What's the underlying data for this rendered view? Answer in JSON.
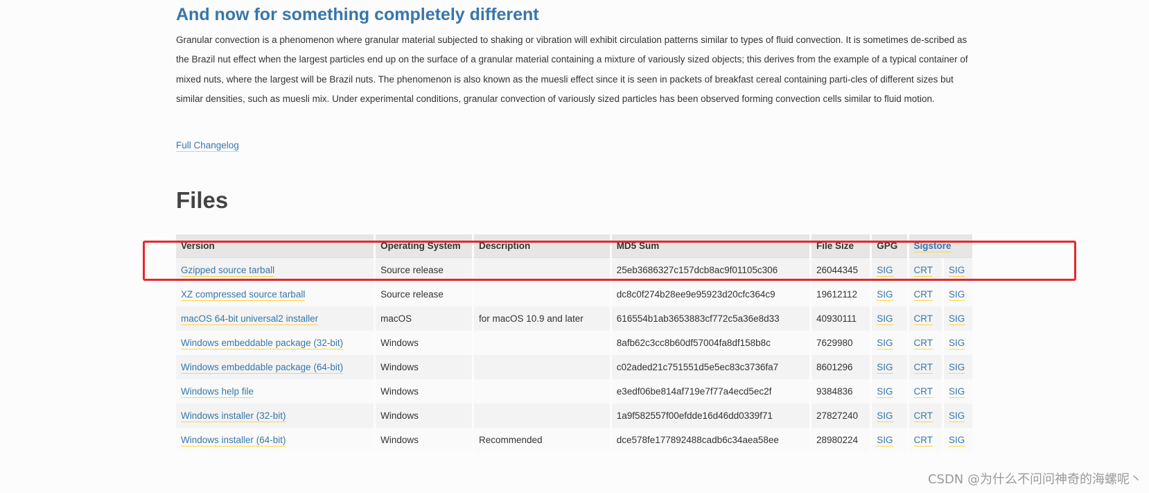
{
  "section": {
    "title": "And now for something completely different",
    "body": "Granular convection is a phenomenon where granular material subjected to shaking or vibration will exhibit circulation patterns similar to types of fluid convection. It is sometimes de-scribed as the Brazil nut effect when the largest particles end up on the surface of a granular material containing a mixture of variously sized objects; this derives from the example of a typical container of mixed nuts, where the largest will be Brazil nuts. The phenomenon is also known as the muesli effect since it is seen in packets of breakfast cereal containing parti-cles of different sizes but similar densities, such as muesli mix. Under experimental conditions, granular convection of variously sized particles has been observed forming convection cells similar to fluid motion.",
    "changelog_label": "Full Changelog"
  },
  "files": {
    "title": "Files",
    "headers": {
      "version": "Version",
      "os": "Operating System",
      "description": "Description",
      "md5": "MD5 Sum",
      "size": "File Size",
      "gpg": "GPG",
      "sigstore": "Sigstore"
    },
    "rows": [
      {
        "version": "Gzipped source tarball",
        "os": "Source release",
        "description": "",
        "md5": "25eb3686327c157dcb8ac9f01105c306",
        "size": "26044345",
        "gpg": "SIG",
        "crt": "CRT",
        "sig": "SIG"
      },
      {
        "version": "XZ compressed source tarball",
        "os": "Source release",
        "description": "",
        "md5": "dc8c0f274b28ee9e95923d20cfc364c9",
        "size": "19612112",
        "gpg": "SIG",
        "crt": "CRT",
        "sig": "SIG"
      },
      {
        "version": "macOS 64-bit universal2 installer",
        "os": "macOS",
        "description": "for macOS 10.9 and later",
        "md5": "616554b1ab3653883cf772c5a36e8d33",
        "size": "40930111",
        "gpg": "SIG",
        "crt": "CRT",
        "sig": "SIG"
      },
      {
        "version": "Windows embeddable package (32-bit)",
        "os": "Windows",
        "description": "",
        "md5": "8afb62c3cc8b60df57004fa8df158b8c",
        "size": "7629980",
        "gpg": "SIG",
        "crt": "CRT",
        "sig": "SIG"
      },
      {
        "version": "Windows embeddable package (64-bit)",
        "os": "Windows",
        "description": "",
        "md5": "c02aded21c751551d5e5ec83c3736fa7",
        "size": "8601296",
        "gpg": "SIG",
        "crt": "CRT",
        "sig": "SIG"
      },
      {
        "version": "Windows help file",
        "os": "Windows",
        "description": "",
        "md5": "e3edf06be814af719e7f77a4ecd5ec2f",
        "size": "9384836",
        "gpg": "SIG",
        "crt": "CRT",
        "sig": "SIG"
      },
      {
        "version": "Windows installer (32-bit)",
        "os": "Windows",
        "description": "",
        "md5": "1a9f582557f00efdde16d46dd0339f71",
        "size": "27827240",
        "gpg": "SIG",
        "crt": "CRT",
        "sig": "SIG"
      },
      {
        "version": "Windows installer (64-bit)",
        "os": "Windows",
        "description": "Recommended",
        "md5": "dce578fe177892488cadb6c34aea58ee",
        "size": "28980224",
        "gpg": "SIG",
        "crt": "CRT",
        "sig": "SIG"
      }
    ]
  },
  "watermark": "CSDN @为什么不问问神奇的海螺呢丶",
  "colors": {
    "link": "#3776ab",
    "link_underline": "#ffd343",
    "highlight": "#e8262a"
  }
}
